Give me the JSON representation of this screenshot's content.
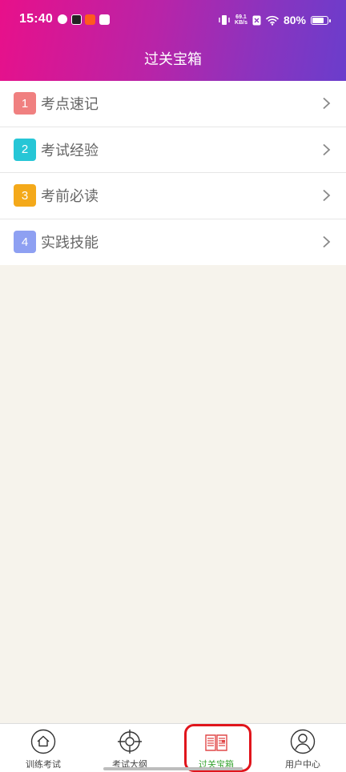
{
  "status_bar": {
    "time": "15:40",
    "net_speed_value": "69.1",
    "net_speed_unit": "KB/s",
    "battery": "80%"
  },
  "header": {
    "title": "过关宝箱"
  },
  "list": [
    {
      "num": "1",
      "label": "考点速记",
      "color": "#f08080"
    },
    {
      "num": "2",
      "label": "考试经验",
      "color": "#26c6d6"
    },
    {
      "num": "3",
      "label": "考前必读",
      "color": "#f4a91a"
    },
    {
      "num": "4",
      "label": "实践技能",
      "color": "#8ea0f2"
    }
  ],
  "tabbar": [
    {
      "label": "训练考试",
      "icon": "home-icon",
      "active": false
    },
    {
      "label": "考试大纲",
      "icon": "target-icon",
      "active": false
    },
    {
      "label": "过关宝箱",
      "icon": "book-icon",
      "active": true
    },
    {
      "label": "用户中心",
      "icon": "user-icon",
      "active": false
    }
  ],
  "colors": {
    "active_tab": "#3ba535",
    "highlight_box": "#e0151c"
  }
}
